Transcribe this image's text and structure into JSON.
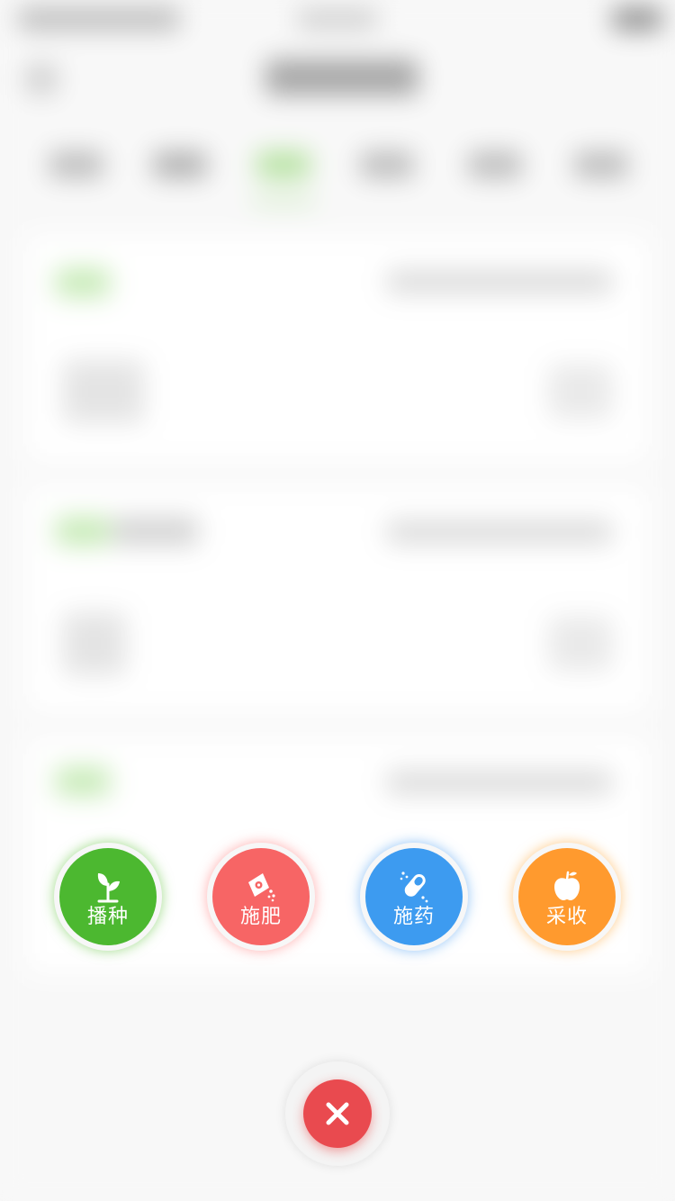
{
  "actions": [
    {
      "id": "sow",
      "label": "播种",
      "icon": "sprout-icon",
      "color": "#4cb830"
    },
    {
      "id": "fertilize",
      "label": "施肥",
      "icon": "fertilizer-bag-icon",
      "color": "#f76565"
    },
    {
      "id": "spray",
      "label": "施药",
      "icon": "pill-capsule-icon",
      "color": "#3d9bf0"
    },
    {
      "id": "harvest",
      "label": "采收",
      "icon": "apple-icon",
      "color": "#ff9a2e"
    }
  ],
  "close": {
    "icon": "close-icon",
    "color": "#e94a4f"
  },
  "accent": {
    "green": "#8fd36f",
    "background": "#f3f3f3"
  }
}
